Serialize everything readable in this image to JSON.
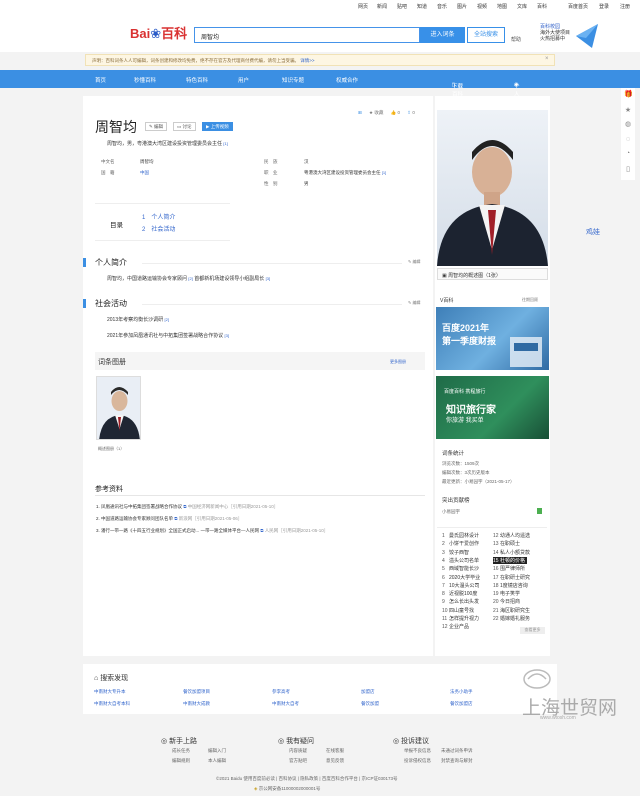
{
  "topbar": {
    "links": [
      "网页",
      "新闻",
      "贴吧",
      "知道",
      "音乐",
      "图片",
      "视频",
      "地图",
      "文库",
      "百科"
    ],
    "right": [
      "百度首页",
      "登录",
      "注册"
    ]
  },
  "header": {
    "logo_a": "Bai",
    "logo_b": "百科",
    "query": "周智均",
    "enter_label": "进入词条",
    "full_label": "全站搜索",
    "help": "帮助",
    "campus": [
      "百科校园",
      "海外大使项目",
      "火热招募中"
    ]
  },
  "notice": {
    "text": "声明：百科词条人人可编辑，词条创建和修改均免费，绝不存在官方及代理商付费代编，请勿上当受骗。",
    "link": "详情>>"
  },
  "nav": {
    "items": [
      "首页",
      "秒懂百科",
      "特色百科",
      "用户",
      "知识专题",
      "权威合作"
    ],
    "app": "下载百科APP",
    "center": "个人中心"
  },
  "entry": {
    "title": "周智均",
    "edit": "编辑",
    "discuss": "讨论",
    "upload": "上传视频",
    "desc": "周智均，男，粤港澳大湾区建设投资管理委员会主任",
    "desc_ref": "[1]",
    "icons": [
      "收藏",
      "0",
      "0"
    ],
    "info": [
      {
        "k": "中文名",
        "v": "周智均"
      },
      {
        "k": "国　籍",
        "v": "中国"
      },
      {
        "k": "民　族",
        "v": "汉"
      },
      {
        "k": "职　业",
        "v": "粤港澳大湾区建设投资管理委员会主任"
      },
      {
        "k": "性　别",
        "v": "男"
      }
    ],
    "info_ref": "[1]"
  },
  "catalog": {
    "label": "目录",
    "items": [
      "1　个人简介",
      "2　社会活动"
    ]
  },
  "sections": [
    {
      "title": "个人简介",
      "edit": "编辑",
      "paras": [
        "周智均，中国道路运输协会专家顾问",
        "首都新机场建设领导小组副局长"
      ],
      "refs": [
        "[2]",
        "[3]"
      ]
    },
    {
      "title": "社会活动",
      "edit": "编辑",
      "paras": [
        "2013年考察均衡长沙调研",
        "2021年参加凤凰通讯社与中拓集团签署战略合作协议"
      ],
      "refs": [
        "[2]",
        "[3]"
      ]
    }
  ],
  "gallery": {
    "title": "词条图册",
    "more": "更多图册",
    "caption": "概述图册（1）"
  },
  "refs": {
    "title": "参考资料",
    "items": [
      {
        "t": "1. 凤凰通讯社与中拓集团签署战略合作协议",
        "s": "中国经济网新闻中心［引用日期2021-05-10］"
      },
      {
        "t": "2. 中国道路运输协会专家顾问团队名单",
        "s": "新浪网［引用日期2021-05-06］"
      },
      {
        "t": "3. 潘行一带一路《十四五行业规划》全国正式启动... 一带一路全媒体平台—人民网",
        "s": "人民网［引用日期2021-05-10］"
      }
    ]
  },
  "side": {
    "photo_caption": "周智均的概述图（1张）",
    "v_title": "V百科",
    "v_more": "往期回顾",
    "b1_l1": "百度2021年",
    "b1_l2": "第一季度财报",
    "b2_logo": "百度百科 携程旅行",
    "b2_l1": "知识旅行家",
    "b2_l2": "你旅游 我买单",
    "stat_title": "词条统计",
    "stats": [
      "浏览次数：1509次",
      "编辑次数：3次历史版本",
      "最近更新：小易园宇（2021-05-17）"
    ],
    "contrib_title": "突出贡献榜",
    "contrib": "小易园宇",
    "rank_left": [
      "曼氏园林设计",
      "小饼干爱创作",
      "饺子西智",
      "溢头公司名单",
      "西域智能长沙",
      "2020大学毕业",
      "10大温头公司",
      "近视脱100度",
      "怎么长出头发",
      "四山童号找",
      "怎样提升视力",
      "企业产品"
    ],
    "rank_right": [
      "幼通人均遥选",
      "在职硕士",
      "私人小额贷款",
      "杜顿的价格",
      "围严律师所",
      "在职研士研究",
      "1度镜店咨询",
      "电子笑学",
      "今日招商",
      "海区职研究生",
      "婚嫁婚礼服务"
    ],
    "rank_more": "查看更多"
  },
  "rail": {
    "icons": [
      "gift-icon",
      "star-icon",
      "weibo-icon",
      "wechat-icon",
      "qq-icon",
      "phone-icon"
    ]
  },
  "float": "鸡娃",
  "discover": {
    "title": "搜索发现",
    "links": [
      "中南财大专升本",
      "中南财大自考本科",
      "餐饮加盟项目",
      "中南财大成教",
      "参李高考",
      "中南财大自考",
      "加盟店",
      "餐饮加盟",
      "法务小助手",
      "餐饮加盟店"
    ]
  },
  "footer": {
    "cols": [
      {
        "h": "新手上路",
        "l": [
          "成长任务",
          "编辑入门",
          "编辑规则",
          "本人编辑"
        ]
      },
      {
        "h": "我有疑问",
        "l": [
          "内容质疑",
          "在线客服",
          "官方贴吧",
          "意见反馈"
        ]
      },
      {
        "h": "投诉建议",
        "l": [
          "举报不良信息",
          "未通过词条申诉",
          "投诉侵权信息",
          "封禁查询与解封"
        ]
      }
    ],
    "copy": "©2021 Baidu 使用百度前必读 | 百科协议 | 隐私政策 | 百度百科合作平台 | 京ICP证030173号",
    "beian": "京公网安备11000002000001号"
  },
  "watermark": {
    "big": "上海世贸网",
    "small": "www.wtosh.com"
  }
}
